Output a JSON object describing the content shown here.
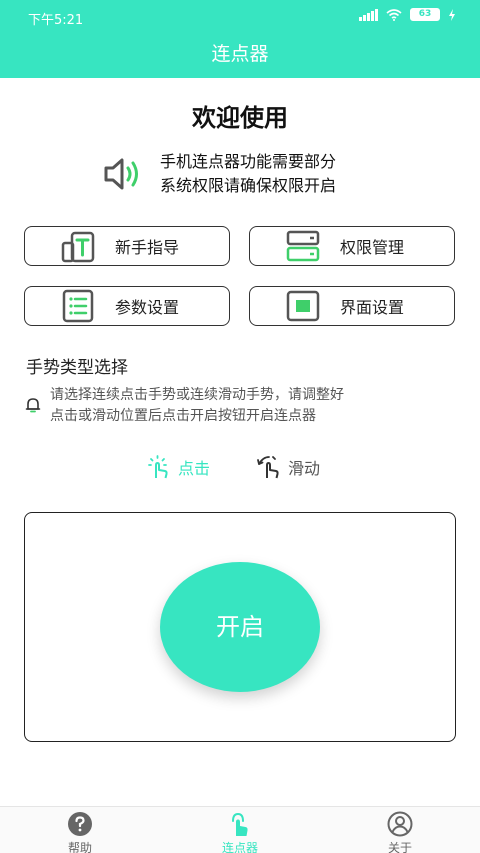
{
  "status_bar": {
    "time": "下午5:21",
    "battery": "63"
  },
  "title_bar": {
    "title": "连点器"
  },
  "welcome": {
    "heading": "欢迎使用"
  },
  "notice": {
    "line1": "手机连点器功能需要部分",
    "line2": "系统权限请确保权限开启"
  },
  "tiles": [
    {
      "label": "新手指导"
    },
    {
      "label": "权限管理"
    },
    {
      "label": "参数设置"
    },
    {
      "label": "界面设置"
    }
  ],
  "gesture": {
    "title": "手势类型选择",
    "hint_line1": "请选择连续点击手势或连续滑动手势，请调整好",
    "hint_line2": "点击或滑动位置后点击开启按钮开启连点器",
    "modes": [
      {
        "label": "点击",
        "selected": true
      },
      {
        "label": "滑动",
        "selected": false
      }
    ]
  },
  "start": {
    "label": "开启"
  },
  "tab_bar": {
    "items": [
      {
        "label": "帮助",
        "active": false
      },
      {
        "label": "连点器",
        "active": true
      },
      {
        "label": "关于",
        "active": false
      }
    ]
  },
  "colors": {
    "accent": "#37e5c1",
    "icon_green": "#3fcf6a",
    "icon_gray": "#555555"
  }
}
